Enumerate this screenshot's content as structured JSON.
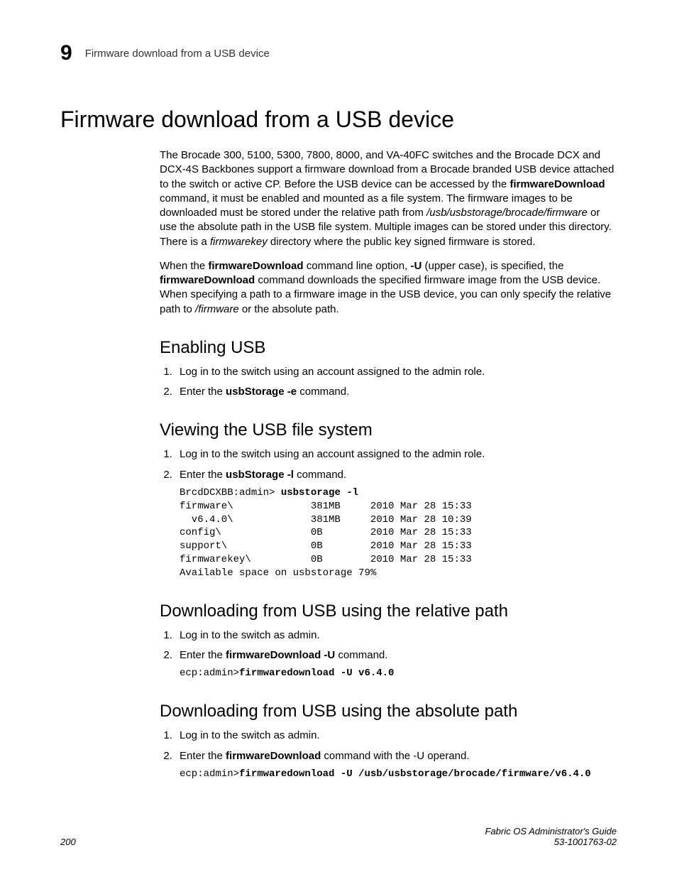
{
  "header": {
    "chapter_number": "9",
    "chapter_title": "Firmware download from a USB device"
  },
  "title": "Firmware download from a USB device",
  "intro": {
    "p1_a": "The Brocade 300, 5100, 5300, 7800, 8000, and VA-40FC switches and the Brocade DCX and DCX-4S Backbones support a firmware download from a Brocade branded USB device attached to the switch or active CP. Before the USB device can be accessed by the ",
    "p1_cmd": "firmwareDownload",
    "p1_b": " command, it must be enabled and mounted as a file system. The firmware images to be downloaded must be stored under the relative path from ",
    "p1_path": "/usb/usbstorage/brocade/firmware",
    "p1_c": " or use the absolute path in the USB file system. Multiple images can be stored under this directory. There is a ",
    "p1_key": "firmwarekey",
    "p1_d": " directory where the public key signed firmware is stored.",
    "p2_a": "When the ",
    "p2_cmd1": "firmwareDownload",
    "p2_b": " command line option,  ",
    "p2_opt": "-U",
    "p2_c": "  (upper case),  is specified, the ",
    "p2_cmd2": "firmwareDownload",
    "p2_d": " command downloads the specified firmware image from the USB device. When specifying a path to a firmware image in the USB device, you can only specify the relative path to ",
    "p2_path": "/firmware",
    "p2_e": " or the absolute path."
  },
  "s1": {
    "heading": "Enabling USB",
    "step1": "Log in to the switch using an account assigned to the admin role.",
    "step2_a": "Enter the ",
    "step2_cmd": "usbStorage -e",
    "step2_b": " command."
  },
  "s2": {
    "heading": "Viewing the USB file system",
    "step1": "Log in to the switch using an account assigned to the admin role.",
    "step2_a": "Enter the ",
    "step2_cmd": "usbStorage -l",
    "step2_b": " command.",
    "code_prompt": "BrcdDCXBB:admin> ",
    "code_cmd": "usbstorage -l",
    "code_body": "firmware\\             381MB     2010 Mar 28 15:33\n  v6.4.0\\             381MB     2010 Mar 28 10:39\nconfig\\               0B        2010 Mar 28 15:33\nsupport\\              0B        2010 Mar 28 15:33\nfirmwarekey\\          0B        2010 Mar 28 15:33\nAvailable space on usbstorage 79%"
  },
  "s3": {
    "heading": "Downloading from USB using the relative path",
    "step1": "Log in to the switch as admin.",
    "step2_a": "Enter the ",
    "step2_cmd": "firmwareDownload -U",
    "step2_b": " command.",
    "code_prompt": "ecp:admin>",
    "code_cmd": "firmwaredownload -U v6.4.0"
  },
  "s4": {
    "heading": "Downloading from USB using the absolute path",
    "step1": "Log in to the switch as admin.",
    "step2_a": "Enter the ",
    "step2_cmd": "firmwareDownload",
    "step2_b": " command with the -U operand.",
    "code_prompt": "ecp:admin>",
    "code_cmd": "firmwaredownload -U /usb/usbstorage/brocade/firmware/v6.4.0"
  },
  "footer": {
    "page": "200",
    "book": "Fabric OS Administrator's Guide",
    "doc": "53-1001763-02"
  }
}
